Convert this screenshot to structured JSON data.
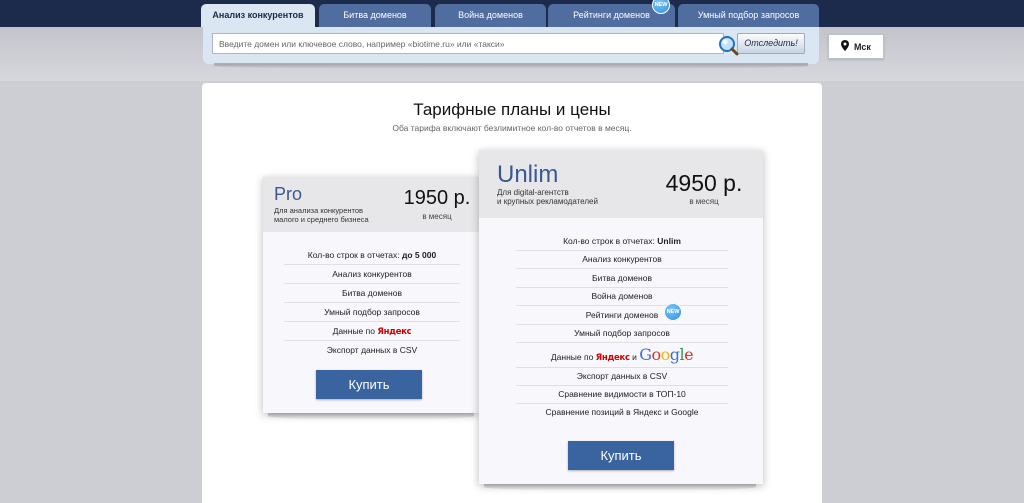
{
  "tabs": [
    {
      "label": "Анализ конкурентов",
      "active": true
    },
    {
      "label": "Битва доменов",
      "active": false
    },
    {
      "label": "Война доменов",
      "active": false
    },
    {
      "label": "Рейтинги доменов",
      "active": false,
      "badge": "NEW"
    },
    {
      "label": "Умный подбор запросов",
      "active": false
    }
  ],
  "search": {
    "placeholder": "Введите домен или ключевое слово, например «biotime.ru» или «такси»",
    "value": "",
    "button_label": "Отследить!"
  },
  "city": {
    "label": "Мск",
    "icon": "map-pin-icon"
  },
  "page": {
    "title": "Тарифные планы и цены",
    "subtitle": "Оба тарифа включают безлимитное кол-во отчетов в месяц."
  },
  "plans": {
    "pro": {
      "name": "Pro",
      "desc_line1": "Для анализа конкурентов",
      "desc_line2": "малого и среднего бизнеса",
      "price": "1950 р.",
      "period": "в месяц",
      "features": {
        "rows_label": "Кол-во строк в отчетах: ",
        "rows_value": "до 5 000",
        "competitor": "Анализ конкурентов",
        "battle": "Битва доменов",
        "smart": "Умный подбор запросов",
        "data_by": "Данные по ",
        "export": "Экспорт данных в CSV"
      },
      "buy_label": "Купить"
    },
    "unlim": {
      "name": "Unlim",
      "desc_line1": "Для digital-агентств",
      "desc_line2": "и крупных рекламодателей",
      "price": "4950 р.",
      "period": "в месяц",
      "features": {
        "rows_label": "Кол-во строк в отчетах: ",
        "rows_value": "Unlim",
        "competitor": "Анализ конкурентов",
        "battle": "Битва доменов",
        "war": "Война доменов",
        "ratings": "Рейтинги доменов",
        "smart": "Умный подбор запросов",
        "data_by": "Данные по ",
        "data_and": " и ",
        "export": "Экспорт данных в CSV",
        "visibility": "Сравнение видимости в ТОП-10",
        "positions": "Сравнение позиций в Яндекс и Google"
      },
      "buy_label": "Купить"
    }
  },
  "badge_text": "NEW",
  "brands": {
    "yandex": "Яндекс",
    "google": "Google"
  },
  "colors": {
    "topbar": "#1c2b4c",
    "tab": "#4f6d9f",
    "tab_active": "#dbe6f3",
    "buy_button": "#3a64a0",
    "plan_name": "#3a5a8f"
  }
}
